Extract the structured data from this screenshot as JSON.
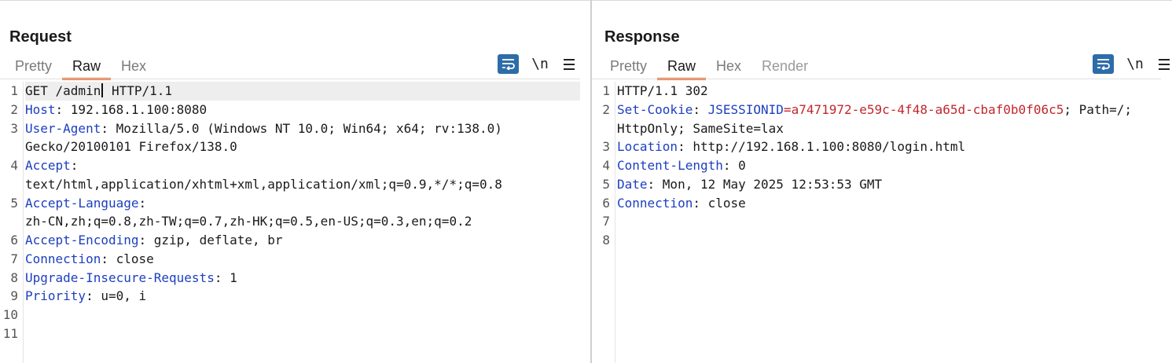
{
  "layout_toggle": {
    "icons": [
      "split-horizontal-icon",
      "split-vertical-icon",
      "single-pane-icon"
    ],
    "active_index": 0,
    "active_color": "#2e6ca8"
  },
  "request": {
    "title": "Request",
    "tabs": [
      "Pretty",
      "Raw",
      "Hex"
    ],
    "active_tab": "Raw",
    "toolbar": {
      "wrap_icon": "word-wrap-icon",
      "newline_label": "\\n",
      "menu_icon": "hamburger-menu-icon"
    },
    "line_numbers": [
      "1",
      "2",
      "3",
      "4",
      "5",
      "6",
      "7",
      "8",
      "9",
      "10",
      "11"
    ],
    "lines": {
      "l1a": "GET /admin",
      "l1b": " HTTP/1.1",
      "h2k": "Host",
      "h2v": ": 192.168.1.100:8080",
      "h3k": "User-Agent",
      "h3v": ": Mozilla/5.0 (Windows NT 10.0; Win64; x64; rv:138.0)",
      "h3c": "Gecko/20100101 Firefox/138.0",
      "h4k": "Accept",
      "h4v": ":",
      "h4c": "text/html,application/xhtml+xml,application/xml;q=0.9,*/*;q=0.8",
      "h5k": "Accept-Language",
      "h5v": ":",
      "h5c": "zh-CN,zh;q=0.8,zh-TW;q=0.7,zh-HK;q=0.5,en-US;q=0.3,en;q=0.2",
      "h6k": "Accept-Encoding",
      "h6v": ": gzip, deflate, br",
      "h7k": "Connection",
      "h7v": ": close",
      "h8k": "Upgrade-Insecure-Requests",
      "h8v": ": 1",
      "h9k": "Priority",
      "h9v": ": u=0, i"
    }
  },
  "response": {
    "title": "Response",
    "tabs": [
      "Pretty",
      "Raw",
      "Hex",
      "Render"
    ],
    "active_tab": "Raw",
    "toolbar": {
      "wrap_icon": "word-wrap-icon",
      "newline_label": "\\n",
      "menu_icon": "hamburger-menu-icon"
    },
    "line_numbers": [
      "1",
      "2",
      "3",
      "4",
      "5",
      "6",
      "7",
      "8"
    ],
    "lines": {
      "l1": "HTTP/1.1 302",
      "h2k": "Set-Cookie",
      "h2sep": ": ",
      "h2ck": "JSESSIONID",
      "h2eq": "=",
      "h2cv": "a7471972-e59c-4f48-a65d-cbaf0b0f06c5",
      "h2rest": "; Path=/;",
      "h2c": "HttpOnly; SameSite=lax",
      "h3k": "Location",
      "h3v": ": http://192.168.1.100:8080/login.html",
      "h4k": "Content-Length",
      "h4v": ": 0",
      "h5k": "Date",
      "h5v": ": Mon, 12 May 2025 12:53:53 GMT",
      "h6k": "Connection",
      "h6v": ": close"
    }
  },
  "colors": {
    "header_key": "#1d3fbf",
    "cookie_value": "#c1272d",
    "active_tab_underline": "#e8662c",
    "button_blue": "#2e6ca8"
  }
}
